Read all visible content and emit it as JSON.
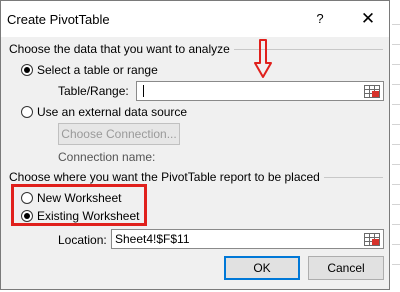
{
  "dialog": {
    "title": "Create PivotTable",
    "help_label": "?",
    "close_label": "✕"
  },
  "section_data": {
    "heading": "Choose the data that you want to analyze",
    "option_table_range": "Select a table or range",
    "table_range_label": "Table/Range:",
    "table_range_value": "",
    "option_external": "Use an external data source",
    "choose_connection_label": "Choose Connection...",
    "connection_name_label": "Connection name:"
  },
  "section_placement": {
    "heading": "Choose where you want the PivotTable report to be placed",
    "option_new": "New Worksheet",
    "option_existing": "Existing Worksheet",
    "location_label": "Location:",
    "location_value": "Sheet4!$F$11"
  },
  "buttons": {
    "ok_label": "OK",
    "cancel_label": "Cancel"
  },
  "colors": {
    "highlight": "#e0201c",
    "arrow": "#e0201c",
    "accent": "#0078d7"
  },
  "icons": {
    "range_selector": "range-select-icon",
    "annotation_arrow": "down-arrow-icon"
  }
}
